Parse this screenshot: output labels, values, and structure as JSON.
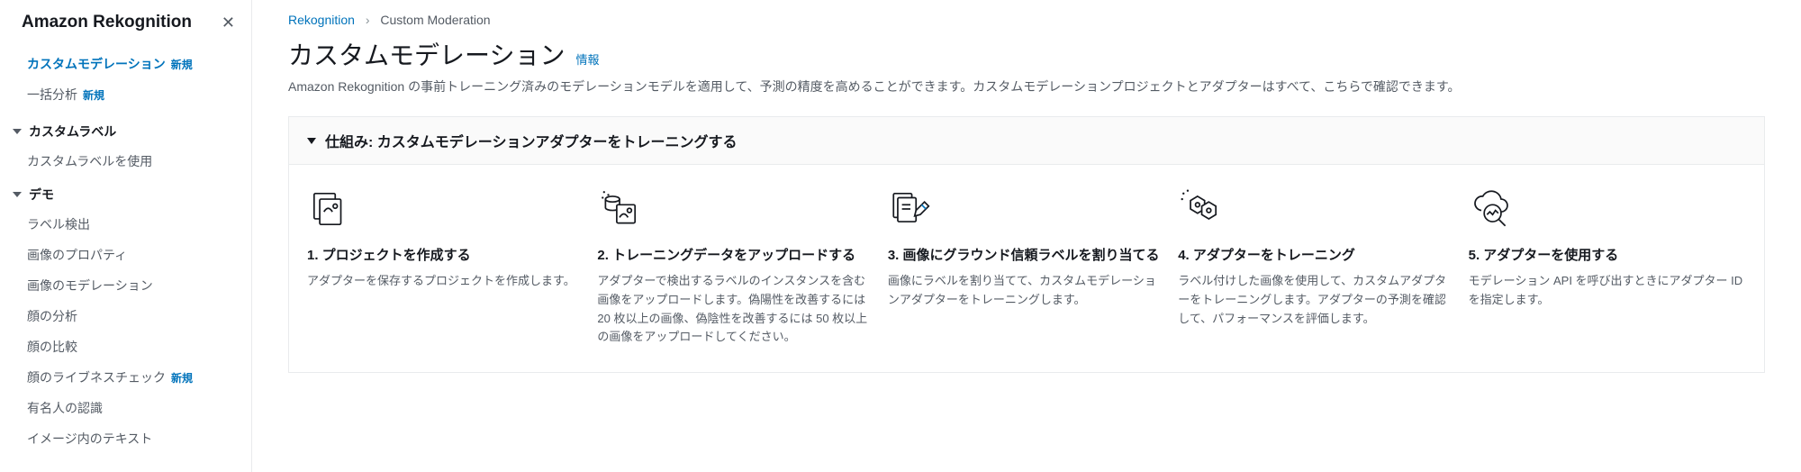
{
  "sidebar": {
    "title": "Amazon Rekognition",
    "items_top": [
      {
        "label": "カスタムモデレーション",
        "badge": "新規",
        "active": true
      },
      {
        "label": "一括分析",
        "badge": "新規",
        "active": false
      }
    ],
    "sections": [
      {
        "label": "カスタムラベル",
        "items": [
          {
            "label": "カスタムラベルを使用"
          }
        ]
      },
      {
        "label": "デモ",
        "items": [
          {
            "label": "ラベル検出"
          },
          {
            "label": "画像のプロパティ"
          },
          {
            "label": "画像のモデレーション"
          },
          {
            "label": "顔の分析"
          },
          {
            "label": "顔の比較"
          },
          {
            "label": "顔のライブネスチェック",
            "badge": "新規"
          },
          {
            "label": "有名人の認識"
          },
          {
            "label": "イメージ内のテキスト"
          }
        ]
      }
    ]
  },
  "breadcrumb": {
    "root": "Rekognition",
    "current": "Custom Moderation"
  },
  "page": {
    "title": "カスタムモデレーション",
    "info": "情報",
    "description": "Amazon Rekognition の事前トレーニング済みのモデレーションモデルを適用して、予測の精度を高めることができます。カスタムモデレーションプロジェクトとアダプターはすべて、こちらで確認できます。"
  },
  "panel": {
    "title": "仕組み: カスタムモデレーションアダプターをトレーニングする"
  },
  "steps": [
    {
      "title": "1. プロジェクトを作成する",
      "desc": "アダプターを保存するプロジェクトを作成します。"
    },
    {
      "title": "2. トレーニングデータをアップロードする",
      "desc": "アダプターで検出するラベルのインスタンスを含む画像をアップロードします。偽陽性を改善するには 20 枚以上の画像、偽陰性を改善するには 50 枚以上の画像をアップロードしてください。"
    },
    {
      "title": "3. 画像にグラウンド信頼ラベルを割り当てる",
      "desc": "画像にラベルを割り当てて、カスタムモデレーションアダプターをトレーニングします。"
    },
    {
      "title": "4. アダプターをトレーニング",
      "desc": "ラベル付けした画像を使用して、カスタムアダプターをトレーニングします。アダプターの予測を確認して、パフォーマンスを評価します。"
    },
    {
      "title": "5. アダプターを使用する",
      "desc": "モデレーション API を呼び出すときにアダプター ID を指定します。"
    }
  ]
}
